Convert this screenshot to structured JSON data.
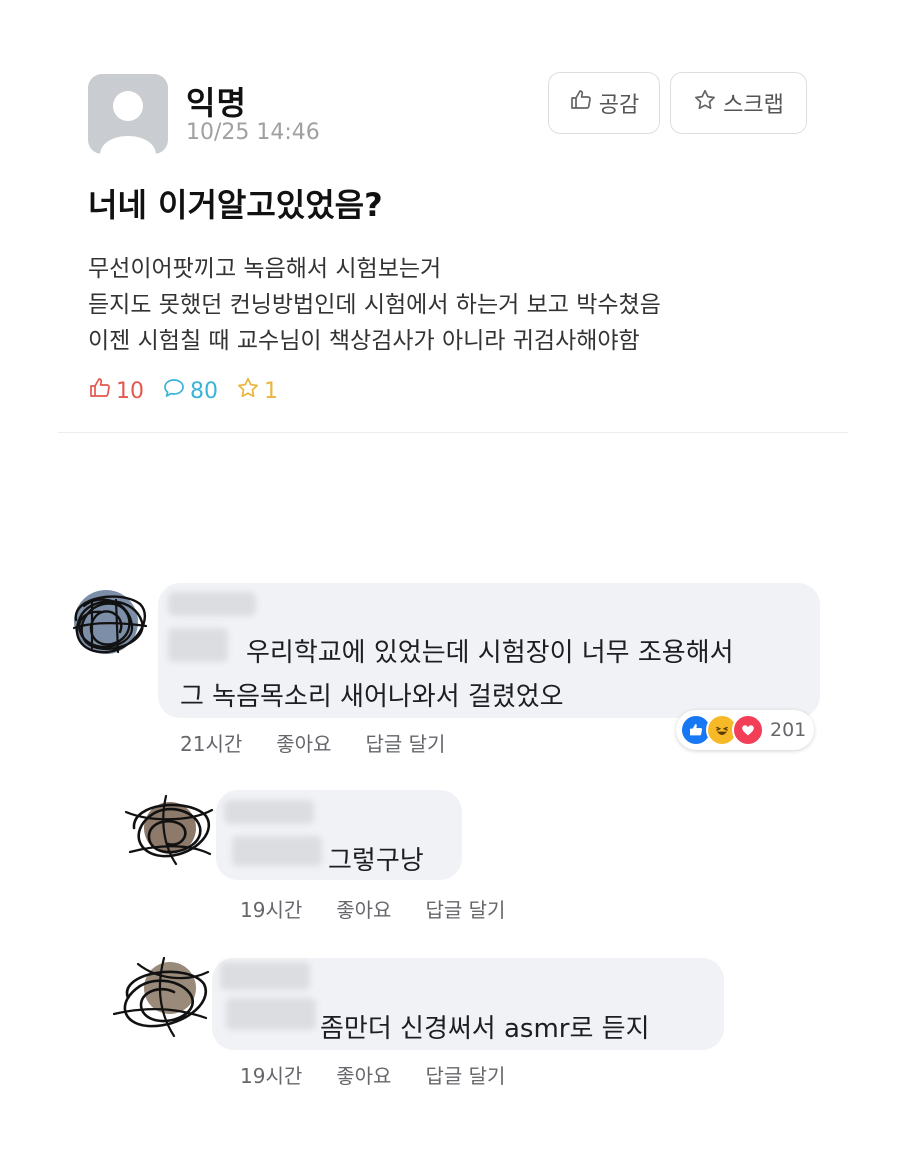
{
  "post": {
    "author": "익명",
    "timestamp": "10/25 14:46",
    "like_button": "공감",
    "scrap_button": "스크랩",
    "title": "너네 이거알고있었음?",
    "body_lines": [
      "무선이어팟끼고 녹음해서 시험보는거",
      "듣지도 못했던 컨닝방법인데 시험에서 하는거 보고 박수쳤음",
      "이젠 시험칠 때 교수님이 책상검사가 아니라 귀검사해야함"
    ],
    "stats": {
      "likes": "10",
      "comments": "80",
      "scraps": "1"
    }
  },
  "comments": [
    {
      "text_lines": [
        "우리학교에 있었는데 시험장이 너무 조용해서",
        "그 녹음목소리 새어나와서 걸렸었오"
      ],
      "time": "21시간",
      "like": "좋아요",
      "reply": "답글 달기",
      "reaction_count": "201"
    },
    {
      "text_lines": [
        "그렇구낭"
      ],
      "time": "19시간",
      "like": "좋아요",
      "reply": "답글 달기"
    },
    {
      "text_lines": [
        "좀만더 신경써서 asmr로 듣지"
      ],
      "time": "19시간",
      "like": "좋아요",
      "reply": "답글 달기"
    }
  ],
  "colors": {
    "like_red": "#e3584e",
    "comment_blue": "#3ab3d9",
    "scrap_yellow": "#e9b53a",
    "bubble_gray": "#f0f2f5"
  },
  "icons": [
    "thumbs-up-icon",
    "star-icon",
    "speech-bubble-icon",
    "fb-like-reaction-icon",
    "fb-haha-reaction-icon",
    "fb-love-reaction-icon"
  ]
}
